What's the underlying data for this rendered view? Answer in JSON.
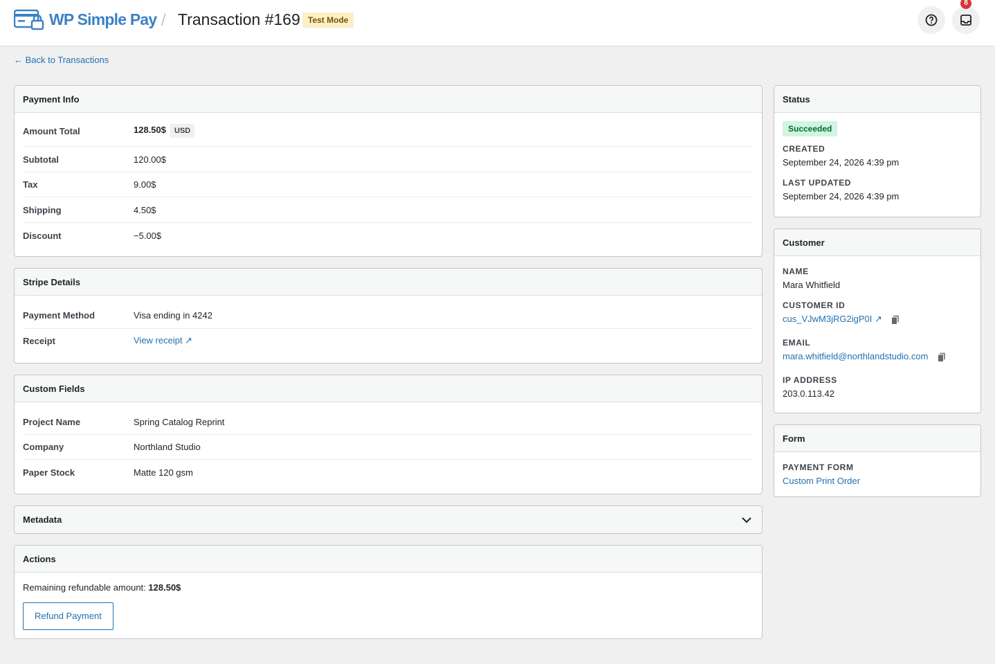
{
  "header": {
    "brand": "WP Simple Pay",
    "separator": "/",
    "title": "Transaction #169",
    "mode_badge": "Test Mode",
    "notification_count": "8"
  },
  "back_link": "← Back to Transactions",
  "payment_info": {
    "title": "Payment Info",
    "rows": [
      {
        "label": "Amount Total",
        "value": "128.50$",
        "currency": "USD"
      },
      {
        "label": "Subtotal",
        "value": "120.00$"
      },
      {
        "label": "Tax",
        "value": "9.00$"
      },
      {
        "label": "Shipping",
        "value": "4.50$"
      },
      {
        "label": "Discount",
        "value": "−5.00$"
      }
    ]
  },
  "stripe_details": {
    "title": "Stripe Details",
    "rows": [
      {
        "label": "Payment Method",
        "value": "Visa ending in 4242"
      },
      {
        "label": "Receipt",
        "value": "View receipt ↗"
      }
    ]
  },
  "custom_fields": {
    "title": "Custom Fields",
    "rows": [
      {
        "label": "Project Name",
        "value": "Spring Catalog Reprint"
      },
      {
        "label": "Company",
        "value": "Northland Studio"
      },
      {
        "label": "Paper Stock",
        "value": "Matte 120 gsm"
      }
    ]
  },
  "metadata": {
    "title": "Metadata"
  },
  "actions": {
    "title": "Actions",
    "remaining_label": "Remaining refundable amount:",
    "remaining_value": "128.50$",
    "refund_button": "Refund Payment"
  },
  "status": {
    "title": "Status",
    "badge": "Succeeded",
    "created_label": "CREATED",
    "created_value": "September 24, 2026 4:39 pm",
    "updated_label": "LAST UPDATED",
    "updated_value": "September 24, 2026 4:39 pm"
  },
  "customer": {
    "title": "Customer",
    "name_label": "NAME",
    "name_value": "Mara Whitfield",
    "id_label": "CUSTOMER ID",
    "id_value": "cus_VJwM3jRG2igP0I ↗",
    "email_label": "EMAIL",
    "email_value": "mara.whitfield@northlandstudio.com",
    "ip_label": "IP ADDRESS",
    "ip_value": "203.0.113.42"
  },
  "form": {
    "title": "Form",
    "label": "PAYMENT FORM",
    "value": "Custom Print Order"
  },
  "colors": {
    "accent": "#2271b1",
    "brand": "#3b82c4",
    "success_bg": "#d1f5e0",
    "test_mode_bg": "#fcf0c6",
    "badge_red": "#d63638"
  }
}
